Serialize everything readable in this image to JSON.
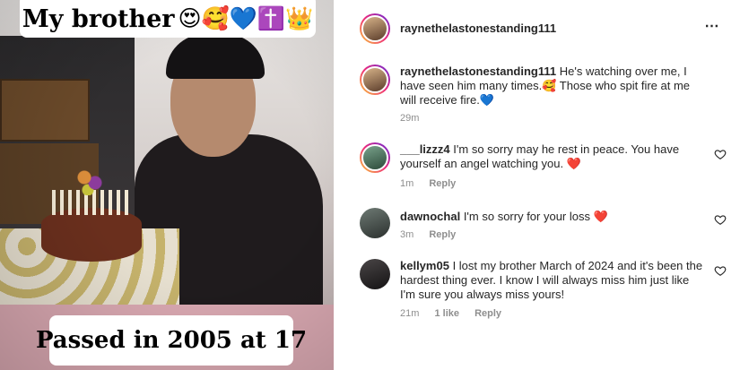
{
  "photo": {
    "caption_top": "My brother",
    "caption_top_emoji": "😍🥰💙✝️👑",
    "caption_bottom": "Passed in 2005 at 17"
  },
  "post": {
    "username": "raynethelastonestanding111",
    "more_icon": "⋯"
  },
  "comments": [
    {
      "username": "raynethelastonestanding111",
      "text": "He's watching over me, I have seen him many times.🥰 Those who spit fire at me will receive fire.💙",
      "time": "29m",
      "avatar_style": "ring"
    },
    {
      "username": "___lizzz4",
      "text": "I'm so sorry may he rest in peace. You have yourself an angel watching you. ❤️",
      "time": "1m",
      "reply_label": "Reply",
      "avatar_style": "ring"
    },
    {
      "username": "dawnochal",
      "text": "I'm so sorry for your loss ❤️",
      "time": "3m",
      "reply_label": "Reply",
      "avatar_style": "plain"
    },
    {
      "username": "kellym05",
      "text": "I lost my brother March of 2024 and it's been the hardest thing ever. I know I will always miss him just like I'm sure you always miss yours!",
      "time": "21m",
      "likes": "1 like",
      "reply_label": "Reply",
      "avatar_style": "plain"
    }
  ],
  "icons": {
    "like": "heart-outline-icon",
    "more": "more-horizontal-icon"
  },
  "colors": {
    "meta_gray": "#8e8e8e",
    "heart_red": "#e0245e",
    "heart_blue": "#1d8fe8"
  }
}
